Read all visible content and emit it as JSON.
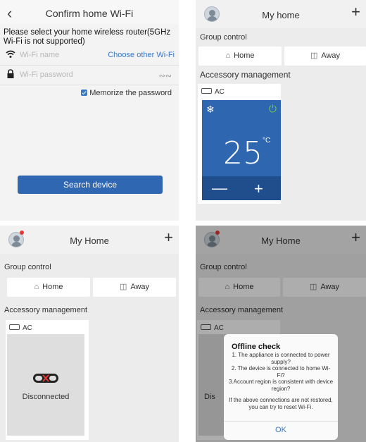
{
  "screen1": {
    "title": "Confirm home Wi-Fi",
    "description": "Please select your home wireless router(5GHz Wi-Fi is not supported)",
    "wifi_name_placeholder": "Wi-Fi name",
    "choose_link": "Choose other Wi-Fi",
    "wifi_password_placeholder": "Wi-Fi password",
    "memorize_label": "Memorize the password",
    "memorize_checked": true,
    "search_button": "Search device"
  },
  "screen2": {
    "title": "My home",
    "group_control": "Group control",
    "home_label": "Home",
    "away_label": "Away",
    "accessory_management": "Accessory management",
    "ac_label": "AC",
    "temperature": "25",
    "temp_unit": "°C"
  },
  "screen3": {
    "title": "My Home",
    "group_control": "Group control",
    "home_label": "Home",
    "away_label": "Away",
    "accessory_management": "Accessory management",
    "ac_label": "AC",
    "status": "Disconnected"
  },
  "screen4": {
    "title": "My Home",
    "group_control": "Group control",
    "home_label": "Home",
    "away_label": "Away",
    "accessory_management": "Accessory management",
    "ac_label": "AC",
    "status_partial": "Dis",
    "dialog": {
      "title": "Offline check",
      "line1": "1. The appliance is connected to power supply?",
      "line2": "2. The device is connected to home Wi-Fi?",
      "line3": "3.Account region is consistent with device region?",
      "footer": "If the above connections are not restored, you can try to reset Wi-Fi.",
      "ok": "OK"
    }
  },
  "colors": {
    "accent": "#3b78c4",
    "button": "#2f67b3",
    "ac_tile": "#2f66b0",
    "power_on": "#6cce3b"
  }
}
